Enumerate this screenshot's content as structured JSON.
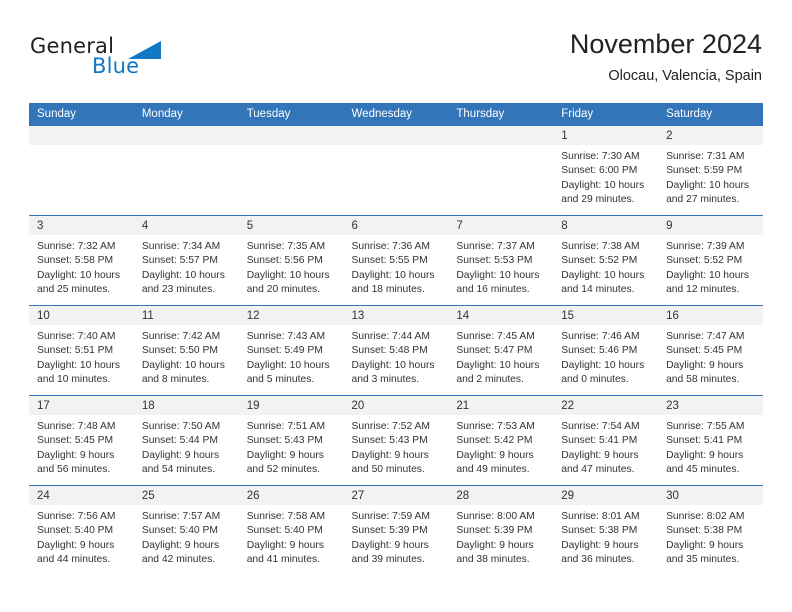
{
  "brand": {
    "name_top": "General",
    "name_bottom": "Blue",
    "accent_color": "#1277c4"
  },
  "header": {
    "title": "November 2024",
    "subtitle": "Olocau, Valencia, Spain"
  },
  "calendar": {
    "header_color": "#3275b8",
    "weekdays": [
      "Sunday",
      "Monday",
      "Tuesday",
      "Wednesday",
      "Thursday",
      "Friday",
      "Saturday"
    ],
    "weeks": [
      [
        {
          "day": "",
          "sunrise": "",
          "sunset": "",
          "daylight": ""
        },
        {
          "day": "",
          "sunrise": "",
          "sunset": "",
          "daylight": ""
        },
        {
          "day": "",
          "sunrise": "",
          "sunset": "",
          "daylight": ""
        },
        {
          "day": "",
          "sunrise": "",
          "sunset": "",
          "daylight": ""
        },
        {
          "day": "",
          "sunrise": "",
          "sunset": "",
          "daylight": ""
        },
        {
          "day": "1",
          "sunrise": "Sunrise: 7:30 AM",
          "sunset": "Sunset: 6:00 PM",
          "daylight": "Daylight: 10 hours and 29 minutes."
        },
        {
          "day": "2",
          "sunrise": "Sunrise: 7:31 AM",
          "sunset": "Sunset: 5:59 PM",
          "daylight": "Daylight: 10 hours and 27 minutes."
        }
      ],
      [
        {
          "day": "3",
          "sunrise": "Sunrise: 7:32 AM",
          "sunset": "Sunset: 5:58 PM",
          "daylight": "Daylight: 10 hours and 25 minutes."
        },
        {
          "day": "4",
          "sunrise": "Sunrise: 7:34 AM",
          "sunset": "Sunset: 5:57 PM",
          "daylight": "Daylight: 10 hours and 23 minutes."
        },
        {
          "day": "5",
          "sunrise": "Sunrise: 7:35 AM",
          "sunset": "Sunset: 5:56 PM",
          "daylight": "Daylight: 10 hours and 20 minutes."
        },
        {
          "day": "6",
          "sunrise": "Sunrise: 7:36 AM",
          "sunset": "Sunset: 5:55 PM",
          "daylight": "Daylight: 10 hours and 18 minutes."
        },
        {
          "day": "7",
          "sunrise": "Sunrise: 7:37 AM",
          "sunset": "Sunset: 5:53 PM",
          "daylight": "Daylight: 10 hours and 16 minutes."
        },
        {
          "day": "8",
          "sunrise": "Sunrise: 7:38 AM",
          "sunset": "Sunset: 5:52 PM",
          "daylight": "Daylight: 10 hours and 14 minutes."
        },
        {
          "day": "9",
          "sunrise": "Sunrise: 7:39 AM",
          "sunset": "Sunset: 5:52 PM",
          "daylight": "Daylight: 10 hours and 12 minutes."
        }
      ],
      [
        {
          "day": "10",
          "sunrise": "Sunrise: 7:40 AM",
          "sunset": "Sunset: 5:51 PM",
          "daylight": "Daylight: 10 hours and 10 minutes."
        },
        {
          "day": "11",
          "sunrise": "Sunrise: 7:42 AM",
          "sunset": "Sunset: 5:50 PM",
          "daylight": "Daylight: 10 hours and 8 minutes."
        },
        {
          "day": "12",
          "sunrise": "Sunrise: 7:43 AM",
          "sunset": "Sunset: 5:49 PM",
          "daylight": "Daylight: 10 hours and 5 minutes."
        },
        {
          "day": "13",
          "sunrise": "Sunrise: 7:44 AM",
          "sunset": "Sunset: 5:48 PM",
          "daylight": "Daylight: 10 hours and 3 minutes."
        },
        {
          "day": "14",
          "sunrise": "Sunrise: 7:45 AM",
          "sunset": "Sunset: 5:47 PM",
          "daylight": "Daylight: 10 hours and 2 minutes."
        },
        {
          "day": "15",
          "sunrise": "Sunrise: 7:46 AM",
          "sunset": "Sunset: 5:46 PM",
          "daylight": "Daylight: 10 hours and 0 minutes."
        },
        {
          "day": "16",
          "sunrise": "Sunrise: 7:47 AM",
          "sunset": "Sunset: 5:45 PM",
          "daylight": "Daylight: 9 hours and 58 minutes."
        }
      ],
      [
        {
          "day": "17",
          "sunrise": "Sunrise: 7:48 AM",
          "sunset": "Sunset: 5:45 PM",
          "daylight": "Daylight: 9 hours and 56 minutes."
        },
        {
          "day": "18",
          "sunrise": "Sunrise: 7:50 AM",
          "sunset": "Sunset: 5:44 PM",
          "daylight": "Daylight: 9 hours and 54 minutes."
        },
        {
          "day": "19",
          "sunrise": "Sunrise: 7:51 AM",
          "sunset": "Sunset: 5:43 PM",
          "daylight": "Daylight: 9 hours and 52 minutes."
        },
        {
          "day": "20",
          "sunrise": "Sunrise: 7:52 AM",
          "sunset": "Sunset: 5:43 PM",
          "daylight": "Daylight: 9 hours and 50 minutes."
        },
        {
          "day": "21",
          "sunrise": "Sunrise: 7:53 AM",
          "sunset": "Sunset: 5:42 PM",
          "daylight": "Daylight: 9 hours and 49 minutes."
        },
        {
          "day": "22",
          "sunrise": "Sunrise: 7:54 AM",
          "sunset": "Sunset: 5:41 PM",
          "daylight": "Daylight: 9 hours and 47 minutes."
        },
        {
          "day": "23",
          "sunrise": "Sunrise: 7:55 AM",
          "sunset": "Sunset: 5:41 PM",
          "daylight": "Daylight: 9 hours and 45 minutes."
        }
      ],
      [
        {
          "day": "24",
          "sunrise": "Sunrise: 7:56 AM",
          "sunset": "Sunset: 5:40 PM",
          "daylight": "Daylight: 9 hours and 44 minutes."
        },
        {
          "day": "25",
          "sunrise": "Sunrise: 7:57 AM",
          "sunset": "Sunset: 5:40 PM",
          "daylight": "Daylight: 9 hours and 42 minutes."
        },
        {
          "day": "26",
          "sunrise": "Sunrise: 7:58 AM",
          "sunset": "Sunset: 5:40 PM",
          "daylight": "Daylight: 9 hours and 41 minutes."
        },
        {
          "day": "27",
          "sunrise": "Sunrise: 7:59 AM",
          "sunset": "Sunset: 5:39 PM",
          "daylight": "Daylight: 9 hours and 39 minutes."
        },
        {
          "day": "28",
          "sunrise": "Sunrise: 8:00 AM",
          "sunset": "Sunset: 5:39 PM",
          "daylight": "Daylight: 9 hours and 38 minutes."
        },
        {
          "day": "29",
          "sunrise": "Sunrise: 8:01 AM",
          "sunset": "Sunset: 5:38 PM",
          "daylight": "Daylight: 9 hours and 36 minutes."
        },
        {
          "day": "30",
          "sunrise": "Sunrise: 8:02 AM",
          "sunset": "Sunset: 5:38 PM",
          "daylight": "Daylight: 9 hours and 35 minutes."
        }
      ]
    ]
  }
}
